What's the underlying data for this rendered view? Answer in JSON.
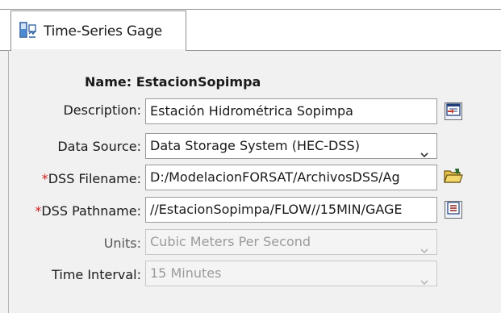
{
  "tab": {
    "label": "Time-Series Gage",
    "icon": "gage-icon"
  },
  "form": {
    "name_label": "Name:",
    "name_value": "EstacionSopimpa",
    "description": {
      "label": "Description:",
      "value": "Estación Hidrométrica Sopimpa"
    },
    "data_source": {
      "label": "Data Source:",
      "value": "Data Storage System (HEC-DSS)"
    },
    "dss_filename": {
      "required_mark": "*",
      "label": "DSS Filename:",
      "value": "D:/ModelacionFORSAT/ArchivosDSS/Ag"
    },
    "dss_pathname": {
      "required_mark": "*",
      "label": "DSS Pathname:",
      "value": "//EstacionSopimpa/FLOW//15MIN/GAGE"
    },
    "units": {
      "label": "Units:",
      "value": "Cubic Meters Per Second"
    },
    "time_interval": {
      "label": "Time Interval:",
      "value": "15 Minutes"
    }
  },
  "colors": {
    "required": "#d11a1a",
    "panel": "#f1f1f1",
    "disabled_text": "#9b9b9b"
  }
}
